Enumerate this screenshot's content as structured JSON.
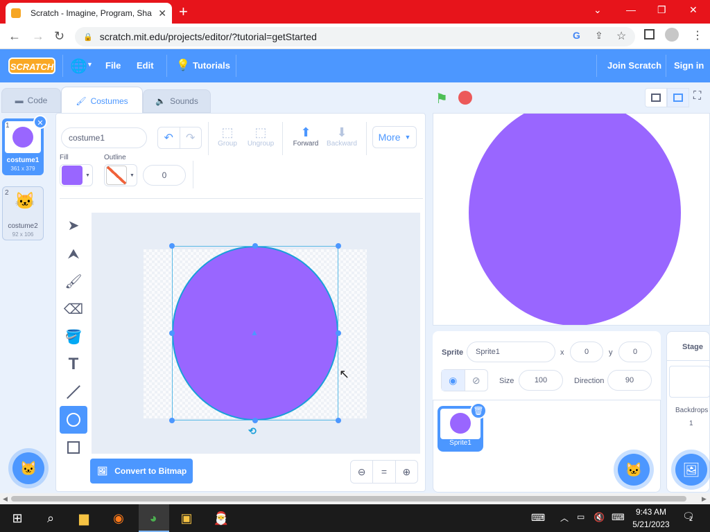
{
  "browser": {
    "tab_title": "Scratch - Imagine, Program, Sha",
    "new_tab": "+",
    "url": "scratch.mit.edu/projects/editor/?tutorial=getStarted",
    "controls": {
      "minimize": "—",
      "restore": "❐",
      "close": "✕",
      "chevron": "⌄"
    }
  },
  "menubar": {
    "logo": "SCRATCH",
    "file": "File",
    "edit": "Edit",
    "tutorials": "Tutorials",
    "join": "Join Scratch",
    "signin": "Sign in"
  },
  "tabs": {
    "code": "Code",
    "costumes": "Costumes",
    "sounds": "Sounds"
  },
  "costumes": [
    {
      "num": "1",
      "name": "costume1",
      "size": "361 x 379",
      "selected": true
    },
    {
      "num": "2",
      "name": "costume2",
      "size": "92 x 106",
      "selected": false
    }
  ],
  "editor": {
    "costume_name": "costume1",
    "group": "Group",
    "ungroup": "Ungroup",
    "forward": "Forward",
    "backward": "Backward",
    "more": "More",
    "fill_label": "Fill",
    "outline_label": "Outline",
    "outline_width": "0",
    "fill_color": "#9966ff",
    "convert": "Convert to Bitmap",
    "zoom_reset": "="
  },
  "sprite": {
    "label": "Sprite",
    "name": "Sprite1",
    "x_label": "x",
    "x": "0",
    "y_label": "y",
    "y": "0",
    "size_label": "Size",
    "size": "100",
    "direction_label": "Direction",
    "direction": "90",
    "tile_name": "Sprite1"
  },
  "stage_pane": {
    "label": "Stage",
    "backdrops_label": "Backdrops",
    "backdrops_count": "1"
  },
  "taskbar": {
    "time": "9:43 AM",
    "date": "5/21/2023",
    "notifications": "2"
  }
}
